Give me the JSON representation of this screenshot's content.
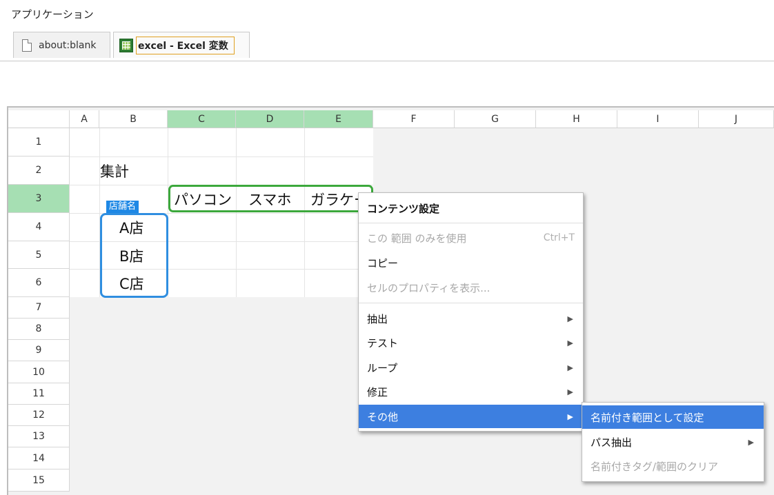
{
  "app": {
    "title": "アプリケーション"
  },
  "tabs": [
    {
      "label": "about:blank",
      "icon": "page-icon",
      "active": false
    },
    {
      "label": "excel - Excel 変数",
      "icon": "excel-icon",
      "active": true
    }
  ],
  "sheet": {
    "columns": [
      "A",
      "B",
      "C",
      "D",
      "E",
      "F",
      "G",
      "H",
      "I",
      "J"
    ],
    "selected_columns": [
      "C",
      "D",
      "E"
    ],
    "rows": [
      "1",
      "2",
      "3",
      "4",
      "5",
      "6",
      "7",
      "8",
      "9",
      "10",
      "11",
      "12",
      "13",
      "14",
      "15"
    ],
    "selected_row": "3",
    "cells": {
      "B2": "集計",
      "C3": "パソコン",
      "D3": "スマホ",
      "E3": "ガラケー",
      "B4": "A店",
      "B5": "B店",
      "B6": "C店"
    },
    "range_tag": "店舗名",
    "colors": {
      "selected_header": "#a6dfb3",
      "green_range": "#3ca83c",
      "blue_range": "#2f8ee0"
    }
  },
  "context_menu": {
    "header": "コンテンツ設定",
    "items": [
      {
        "label": "この 範囲 のみを使用",
        "shortcut": "Ctrl+T",
        "disabled": true
      },
      {
        "label": "コピー",
        "disabled": false
      },
      {
        "label": "セルのプロパティを表示...",
        "disabled": true
      },
      {
        "label": "抽出",
        "submenu": true
      },
      {
        "label": "テスト",
        "submenu": true
      },
      {
        "label": "ループ",
        "submenu": true
      },
      {
        "label": "修正",
        "submenu": true
      },
      {
        "label": "その他",
        "submenu": true,
        "highlighted": true
      }
    ],
    "highlight_color": "#3d7fe0"
  },
  "submenu": {
    "items": [
      {
        "label": "名前付き範囲として設定",
        "highlighted": true
      },
      {
        "label": "パス抽出",
        "submenu": true
      },
      {
        "label": "名前付きタグ/範囲のクリア",
        "disabled": true
      }
    ]
  }
}
